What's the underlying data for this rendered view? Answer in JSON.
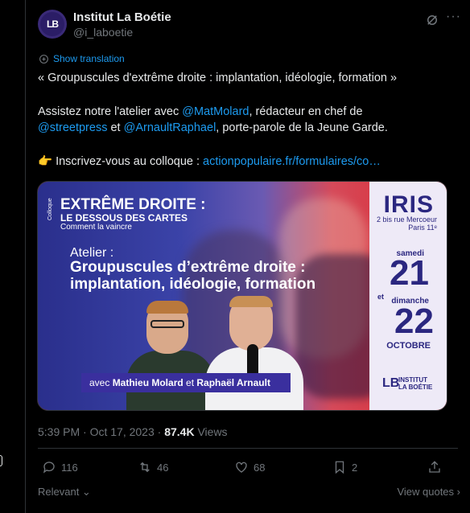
{
  "author": {
    "name": "Institut La Boétie",
    "handle": "@i_laboetie",
    "avatar_text": "LB"
  },
  "icons": {
    "grok": "grok-icon",
    "more": "more-icon",
    "translate": "translate-icon",
    "reply": "reply-icon",
    "retweet": "retweet-icon",
    "like": "heart-icon",
    "bookmark": "bookmark-icon",
    "share": "share-icon"
  },
  "translate_label": "Show translation",
  "post": {
    "line1": "« Groupuscules d'extrême droite : implantation, idéologie, formation »",
    "line2_pre": "Assistez notre l'atelier avec ",
    "mention1": "@MatMolard",
    "line2_post": ", rédacteur en chef de",
    "mention2": "@streetpress",
    "line3_mid": " et ",
    "mention3": "@ArnaultRaphael",
    "line3_post": ", porte-parole de la Jeune Garde.",
    "emoji": "👉",
    "line4_pre": " Inscrivez-vous au colloque : ",
    "link": "actionpopulaire.fr/formulaires/co…"
  },
  "media": {
    "colloque_tag": "Colloque",
    "title1": "EXTRÊME DROITE :",
    "title2": "LE DESSOUS DES CARTES",
    "title3": "Comment la vaincre",
    "atelier": "Atelier :",
    "headline1": "Groupuscules d’extrême droite :",
    "headline2": "implantation, idéologie, formation",
    "caption_pre": "avec ",
    "caption_name1": "Mathieu Molard",
    "caption_mid": " et ",
    "caption_name2": "Raphaël Arnault",
    "venue": "IRIS",
    "address1": "2 bis rue Mercoeur",
    "address2": "Paris 11ᵉ",
    "samedi": "samedi",
    "day1": "21",
    "et": "et",
    "dimanche": "dimanche",
    "day2": "22",
    "month": "OCTOBRE",
    "logo_mark": "LB",
    "logo_line1": "INSTITUT",
    "logo_line2": "LA BOÉTIE"
  },
  "meta": {
    "time": "5:39 PM",
    "sep": " · ",
    "date": "Oct 17, 2023",
    "views_count": "87.4K",
    "views_label": " Views"
  },
  "actions": {
    "replies": "116",
    "retweets": "46",
    "likes": "68",
    "bookmarks": "2"
  },
  "footer": {
    "relevant": "Relevant",
    "view_quotes": "View quotes"
  }
}
